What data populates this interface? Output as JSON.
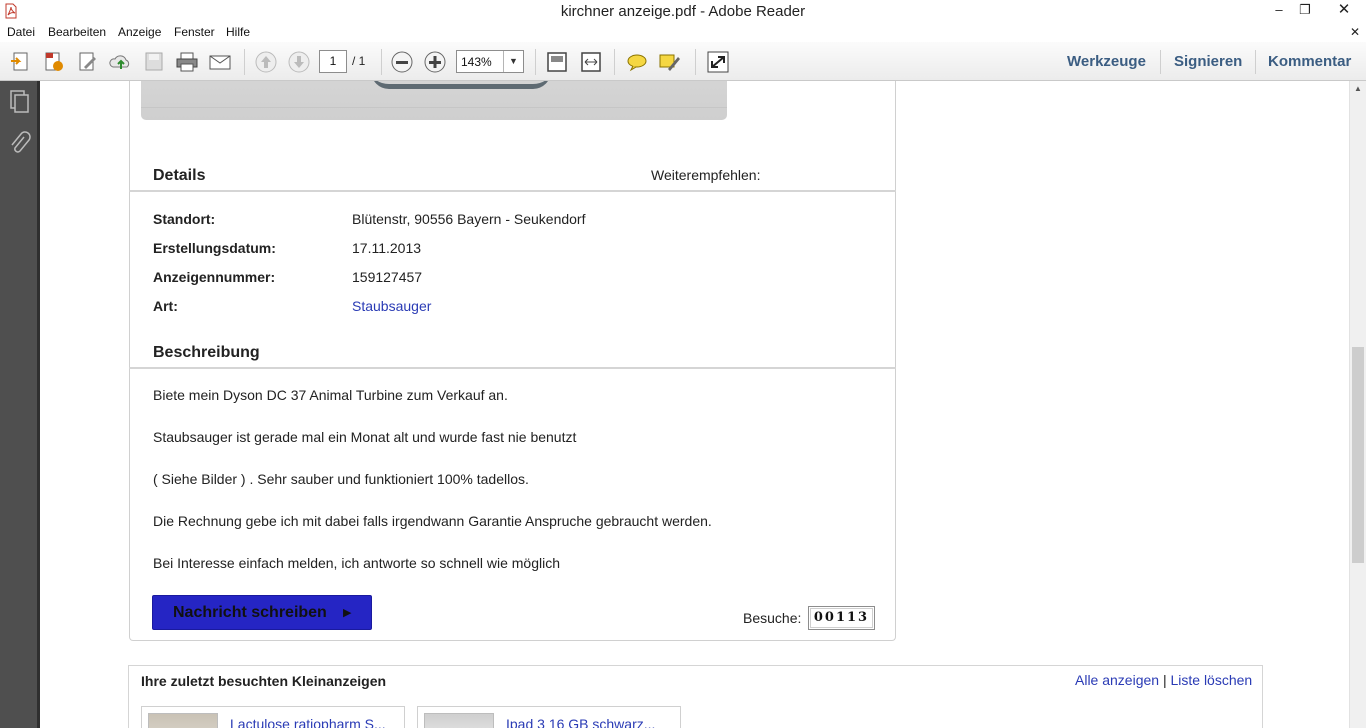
{
  "window": {
    "title": "kirchner anzeige.pdf - Adobe Reader",
    "minimize_glyph": "–",
    "maximize_glyph": "❐",
    "close_glyph": "✕"
  },
  "menu": {
    "items": [
      "Datei",
      "Bearbeiten",
      "Anzeige",
      "Fenster",
      "Hilfe"
    ],
    "doc_close_glyph": "✕"
  },
  "toolbar": {
    "page_current": "1",
    "page_total": "/ 1",
    "zoom": "143%",
    "links": [
      "Werkzeuge",
      "Signieren",
      "Kommentar"
    ],
    "icons": [
      "create-pdf-icon",
      "open-pdf-icon",
      "edit-pdf-icon",
      "upload-cloud-icon",
      "save-icon",
      "print-icon",
      "email-icon",
      "previous-page-icon",
      "next-page-icon",
      "zoom-out-icon",
      "zoom-in-icon",
      "fit-page-icon",
      "fit-width-icon",
      "comment-icon",
      "highlight-icon",
      "fullscreen-icon"
    ]
  },
  "leftnav": {
    "icons": [
      "pages-icon",
      "attachments-icon"
    ]
  },
  "details": {
    "title": "Details",
    "share_label": "Weiterempfehlen:",
    "rows": [
      {
        "label": "Standort:",
        "value": "Blütenstr, 90556 Bayern - Seukendorf"
      },
      {
        "label": "Erstellungsdatum:",
        "value": "17.11.2013"
      },
      {
        "label": "Anzeigennummer:",
        "value": "159127457"
      },
      {
        "label": "Art:",
        "value": "Staubsauger"
      }
    ]
  },
  "description": {
    "title": "Beschreibung",
    "lines": [
      "Biete mein Dyson DC 37 Animal Turbine zum Verkauf an.",
      "Staubsauger ist gerade mal ein Monat alt und wurde fast nie benutzt",
      "( Siehe Bilder ) . Sehr sauber und funktioniert 100% tadellos.",
      "Die Rechnung gebe ich mit dabei falls irgendwann Garantie Anspruche gebraucht werden.",
      "Bei Interesse einfach melden, ich antworte so schnell wie möglich"
    ]
  },
  "contact": {
    "button_label": "Nachricht schreiben",
    "button_arrow": "▶",
    "visits_label": "Besuche:",
    "visits_count": "00113"
  },
  "recent": {
    "title": "Ihre zuletzt besuchten Kleinanzeigen",
    "show_all": "Alle anzeigen",
    "pipe": "|",
    "clear": "Liste löschen",
    "items": [
      {
        "label": "Lactulose ratiopharm S..."
      },
      {
        "label": "Ipad 3 16 GB schwarz..."
      }
    ]
  },
  "colors": {
    "link": "#2a3bb5",
    "button": "#2525c4",
    "toolbar_link": "#3b5d82",
    "nav_pane": "#4f4f4f"
  }
}
